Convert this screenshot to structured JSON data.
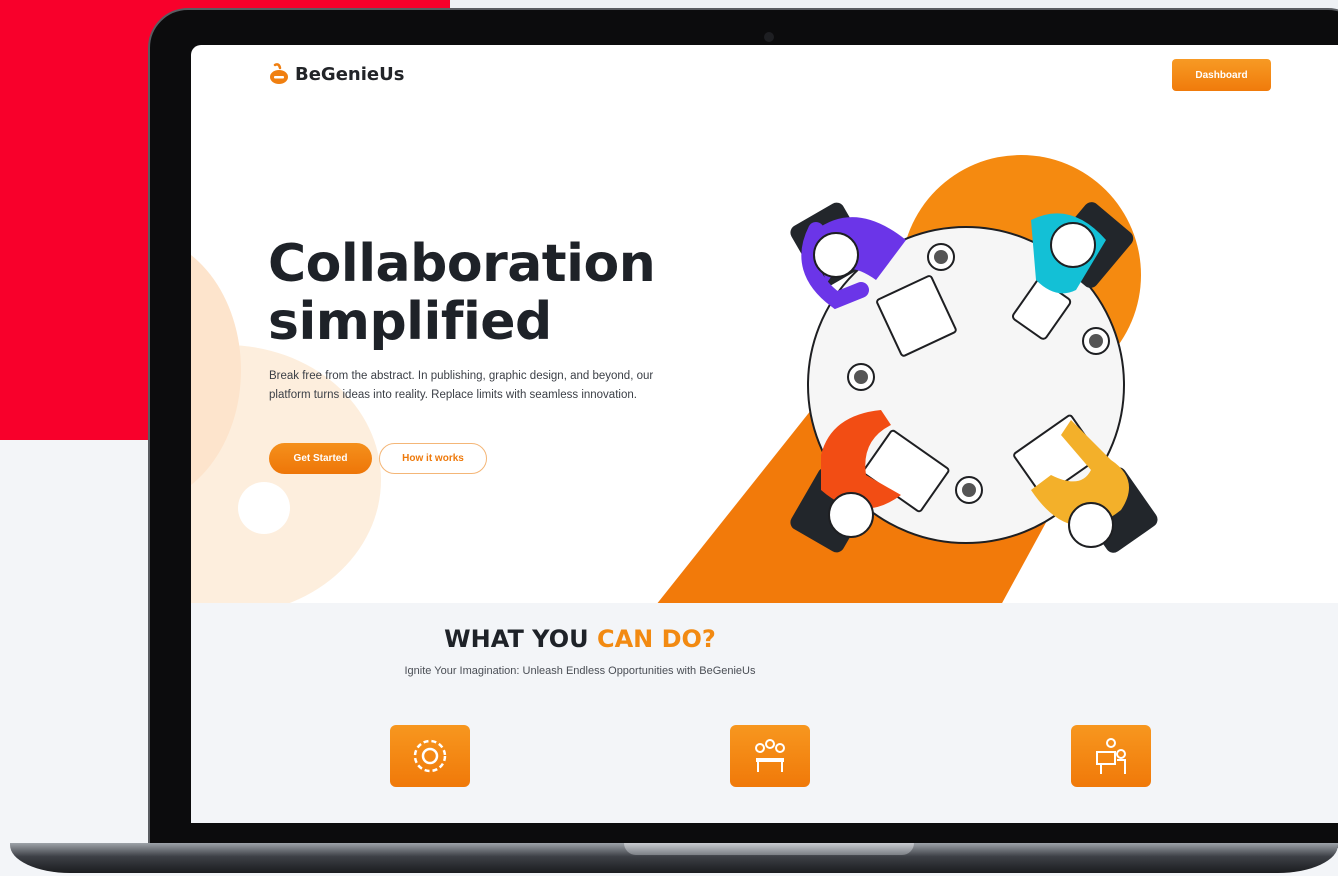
{
  "header": {
    "logo_text": "BeGenieUs",
    "dashboard_label": "Dashboard"
  },
  "hero": {
    "title_line1": "Collaboration",
    "title_line2": "simplified",
    "description": "Break free from the abstract. In publishing, graphic design, and beyond, our platform turns ideas into reality. Replace limits with seamless innovation.",
    "primary_cta": "Get Started",
    "secondary_cta": "How it works"
  },
  "features": {
    "title_part1": "WHAT YOU",
    "title_part2": "CAN DO?",
    "subtitle": "Ignite Your Imagination: Unleash Endless Opportunities with BeGenieUs",
    "icons": [
      "brain-gear-icon",
      "team-meeting-icon",
      "presentation-icon"
    ]
  },
  "colors": {
    "accent": "#f28a12",
    "background_red": "#f8002b",
    "text_dark": "#1e2228"
  }
}
